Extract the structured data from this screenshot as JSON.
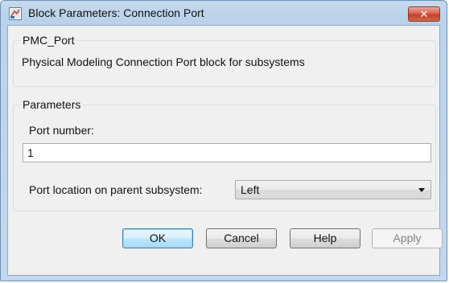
{
  "window": {
    "title": "Block Parameters: Connection Port",
    "icon": "simulink-block-icon",
    "close_glyph": "✕"
  },
  "block_info": {
    "group_title": "PMC_Port",
    "description": "Physical Modeling Connection Port block for subsystems"
  },
  "parameters": {
    "group_title": "Parameters",
    "port_number_label": "Port number:",
    "port_number_value": "1",
    "port_location_label": "Port location on parent subsystem:",
    "port_location_value": "Left"
  },
  "buttons": {
    "ok": "OK",
    "cancel": "Cancel",
    "help": "Help",
    "apply": "Apply"
  },
  "colors": {
    "title_bar": "#b9d1ea",
    "close_button": "#c4412a",
    "default_button_border": "#3c7fb1"
  }
}
